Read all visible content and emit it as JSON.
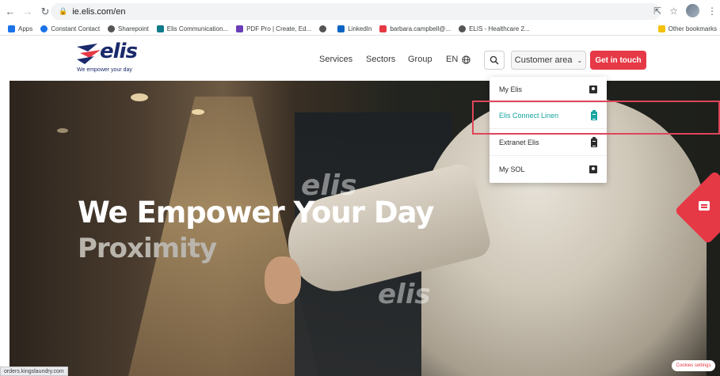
{
  "browser": {
    "url": "ie.elis.com/en",
    "bookmarks": [
      {
        "label": "Apps",
        "color": "#1a73e8"
      },
      {
        "label": "Constant Contact",
        "color": "#1a73e8"
      },
      {
        "label": "Sharepoint",
        "color": "#555555"
      },
      {
        "label": "Elis Communication...",
        "color": "#0f7a8a"
      },
      {
        "label": "PDF Pro | Create, Ed...",
        "color": "#6a3db8"
      },
      {
        "label": "",
        "color": "#555555"
      },
      {
        "label": "LinkedIn",
        "color": "#0a66c2"
      },
      {
        "label": "barbara.campbell@...",
        "color": "#e63946"
      },
      {
        "label": "ELIS - Healthcare 2...",
        "color": "#555555"
      }
    ],
    "other_bookmarks": "Other bookmarks",
    "status_url": "orders.kingslaundry.com"
  },
  "header": {
    "logo_text": "elis",
    "logo_tagline": "We empower your day",
    "nav": [
      "Services",
      "Sectors",
      "Group"
    ],
    "lang": "EN",
    "customer_area": "Customer area",
    "cta": "Get in touch"
  },
  "dropdown": {
    "items": [
      {
        "label": "My Elis",
        "icon": "contact-card-icon"
      },
      {
        "label": "Elis Connect Linen",
        "icon": "clipboard-icon"
      },
      {
        "label": "Extranet Elis",
        "icon": "clipboard-icon"
      },
      {
        "label": "My SOL",
        "icon": "contact-card-icon"
      }
    ]
  },
  "hero": {
    "title": "We Empower Your Day",
    "subtitle": "Proximity",
    "print_1": "elis",
    "print_2": "elis"
  },
  "cookie_settings": "Cookies settings",
  "colors": {
    "brand_red": "#e63946",
    "brand_navy": "#1a2a6c",
    "active_teal": "#16a5a0",
    "highlight": "#e0455a"
  }
}
